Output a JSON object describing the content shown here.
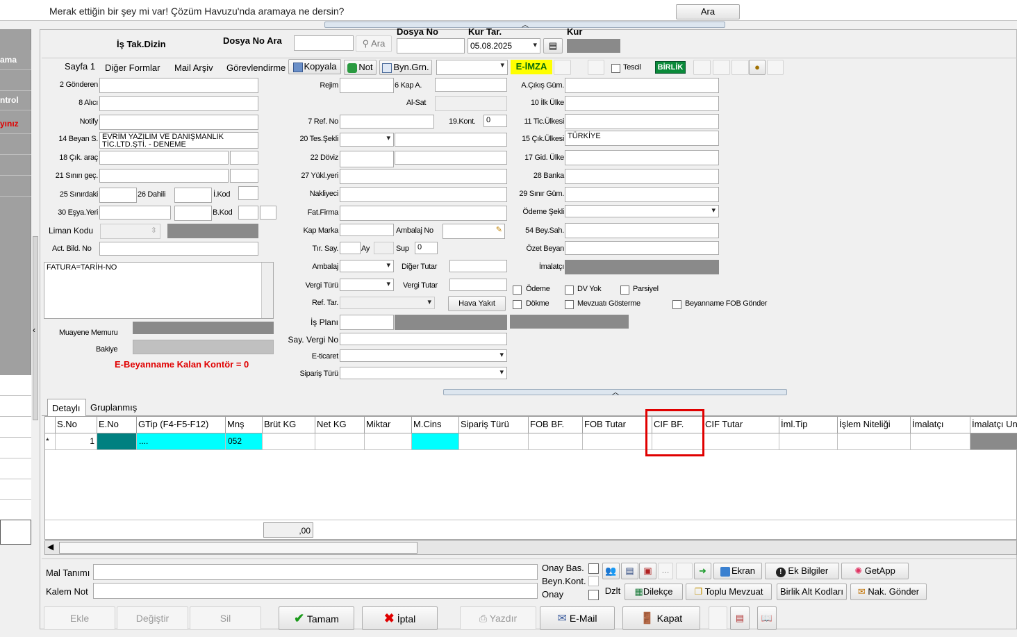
{
  "top": {
    "question": "Merak ettiğin bir şey mi var! Çözüm Havuzu'nda aramaya ne dersin?",
    "search_button": "Ara"
  },
  "sidebar": {
    "items": [
      "ama",
      "",
      "ntrol",
      "yınız"
    ]
  },
  "header": {
    "is_tak_dizin": "İş Tak.Dizin",
    "dosya_no_ara_label": "Dosya No Ara",
    "ara_button": "Ara",
    "dosya_no_label": "Dosya No",
    "kur_tar_label": "Kur Tar.",
    "kur_tar_value": "05.08.2025",
    "kur_label": "Kur"
  },
  "tabs": [
    "Sayfa 1",
    "Diğer Formlar",
    "Mail Arşiv",
    "Görevlendirme"
  ],
  "toolbar": {
    "kopyala": "Kopyala",
    "not": "Not",
    "byn_grn": "Byn.Grn.",
    "eimza": "E-İMZA",
    "tescil": "Tescil",
    "birlik": "BİRLİK"
  },
  "left": {
    "gonderen": "2 Gönderen",
    "alici": "8 Alıcı",
    "notify": "Notify",
    "beyan_s": "14 Beyan S.",
    "beyan_s_value": "EVRİM YAZILIM VE DANIŞMANLIK TİC.LTD.ŞTİ. - DENEME",
    "cik_arac": "18 Çık. araç",
    "sinir_gec": "21 Sınırı geç.",
    "sinirdaki": "25 Sınırdaki",
    "dahili": "26 Dahili",
    "i_kod": "İ.Kod",
    "esya_yeri": "30 Eşya.Yeri",
    "b_kod": "B.Kod",
    "liman_kodu": "Liman Kodu",
    "act_bild_no": "Act. Bild. No",
    "memo": "FATURA=TARİH-NO",
    "muayene_memuru": "Muayene Memuru",
    "bakiye": "Bakiye",
    "kontor": "E-Beyanname Kalan Kontör = 0"
  },
  "mid": {
    "rejim": "Rejim",
    "kap_a": "6 Kap A.",
    "al_sat": "Al-Sat",
    "ref_no": "7 Ref. No",
    "kont": "19.Kont.",
    "kont_value": "0",
    "tes_sekli": "20 Tes.Şekli",
    "doviz": "22 Döviz",
    "yuk_yeri": "27 Yükl.yeri",
    "nakliyeci": "Nakliyeci",
    "fat_firma": "Fat.Firma",
    "kap_marka": "Kap Marka",
    "ambalaj_no": "Ambalaj No",
    "tir_say": "Tır. Say.",
    "ay": "Ay",
    "sup": "Sup",
    "sup_value": "0",
    "ambalaj": "Ambalaj",
    "diger_tutar": "Diğer Tutar",
    "vergi_turu": "Vergi Türü",
    "vergi_tutar": "Vergi Tutar",
    "ref_tar": "Ref. Tar.",
    "hava_yakit": "Hava Yakıt",
    "is_plani": "İş Planı",
    "say_vergi_no": "Say. Vergi No",
    "e_ticaret": "E-ticaret",
    "siparis_turu": "Sipariş Türü"
  },
  "right": {
    "a_cikis_gum": "A.Çıkış Güm.",
    "ilk_ulke": "10 İlk Ülke",
    "tic_ulkesi": "11 Tic.Ülkesi",
    "cik_ulkesi": "15 Çık.Ülkesi",
    "cik_ulkesi_value": "TÜRKİYE",
    "gid_ulke": "17 Gid. Ülke",
    "banka": "28 Banka",
    "sinir_gum": "29 Sınır Güm.",
    "odeme_sekli": "Ödeme Şekli",
    "bey_sah": "54 Bey.Sah.",
    "ozet_beyan": "Özet Beyan",
    "imalatci": "İmalatçı"
  },
  "checks": {
    "odeme": "Ödeme",
    "dv_yok": "DV Yok",
    "parsiyel": "Parsiyel",
    "dokme": "Dökme",
    "mevzuati": "Mevzuatı Gösterme",
    "fob_gonder": "Beyanname FOB Gönder"
  },
  "grid": {
    "tabs": [
      "Detaylı",
      "Gruplanmış"
    ],
    "columns": [
      "",
      "S.No",
      "E.No",
      "GTip (F4-F5-F12)",
      "Mnş",
      "Brüt KG",
      "Net KG",
      "Miktar",
      "M.Cins",
      "Sipariş Türü",
      "FOB BF.",
      "FOB Tutar",
      "CIF BF.",
      "CIF Tutar",
      "İml.Tip",
      "İşlem Niteliği",
      "İmalatçı",
      "İmalatçı Un"
    ],
    "row": [
      "*",
      "1",
      "",
      "....",
      "052",
      "",
      "",
      "",
      "",
      "",
      "",
      "",
      "",
      "",
      "",
      "",
      "",
      ""
    ],
    "total": ",00"
  },
  "lower": {
    "mal_tanimi": "Mal Tanımı",
    "kalem_not": "Kalem Not",
    "onay_bas": "Onay Bas.",
    "beyn_kont": "Beyn.Kont.",
    "onay": "Onay",
    "dzlt": "Dzlt",
    "dilekce": "Dilekçe",
    "ekran": "Ekran",
    "ek_bilgiler": "Ek Bilgiler",
    "getapp": "GetApp",
    "toplu_mevzuat": "Toplu Mevzuat",
    "birlik_alt": "Birlik Alt Kodları",
    "nak_gonder": "Nak. Gönder"
  },
  "buttons": {
    "ekle": "Ekle",
    "degistir": "Değiştir",
    "sil": "Sil",
    "tamam": "Tamam",
    "iptal": "İptal",
    "yazdir": "Yazdır",
    "email": "E-Mail",
    "kapat": "Kapat"
  },
  "colors": {
    "highlight": "#e00000",
    "teal": "#008080",
    "cyan": "#00ffff",
    "eimza_bg": "#ffff00"
  }
}
